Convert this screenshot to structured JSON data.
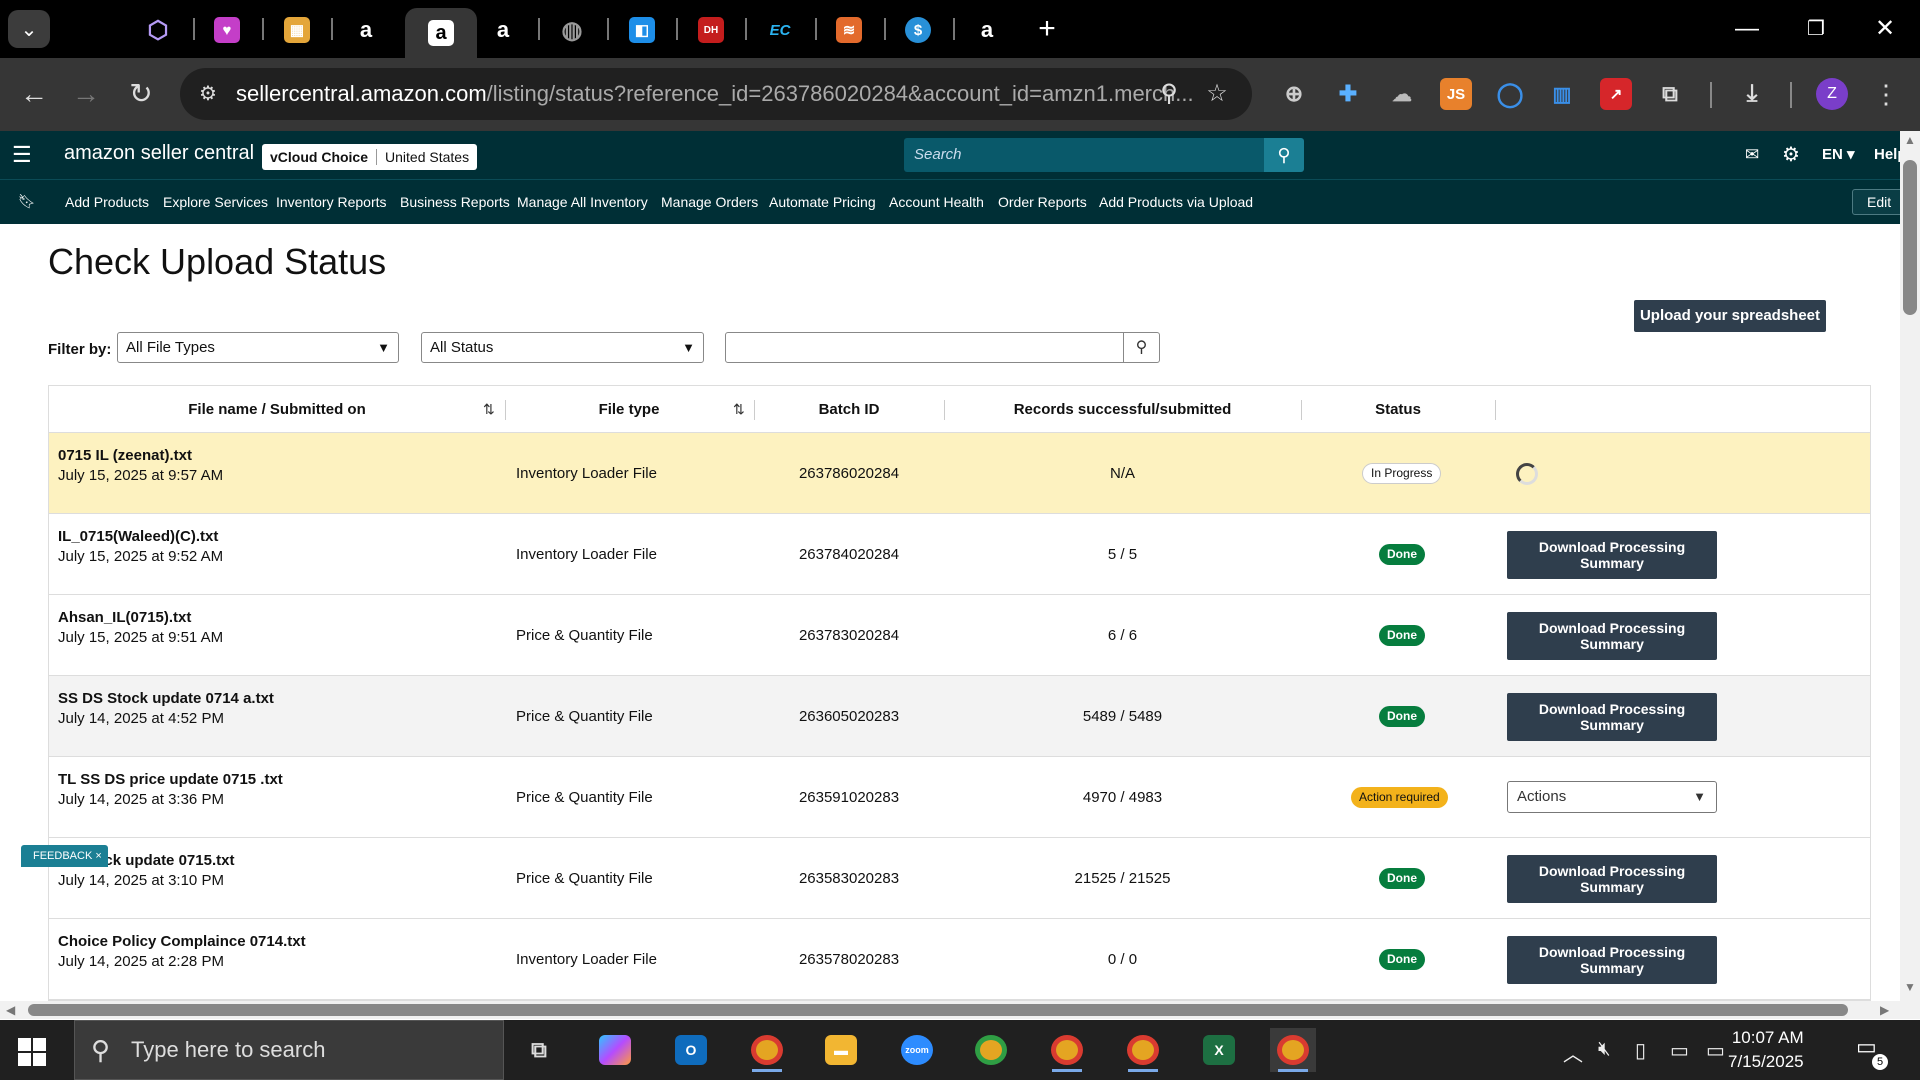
{
  "browser": {
    "url_host": "sellercentral.amazon.com",
    "url_path": "/listing/status?reference_id=263786020284&account_id=amzn1.merch...",
    "new_tab_label": "+"
  },
  "header": {
    "logo_text": "amazon seller central",
    "account_name": "vCloud Choice",
    "marketplace": "United States",
    "search_placeholder": "Search",
    "language": "EN",
    "help": "Help"
  },
  "nav": {
    "items": [
      "Add Products",
      "Explore Services",
      "Inventory Reports",
      "Business Reports",
      "Manage All Inventory",
      "Manage Orders",
      "Automate Pricing",
      "Account Health",
      "Order Reports",
      "Add Products via Upload"
    ],
    "edit_label": "Edit"
  },
  "page": {
    "title": "Check Upload Status",
    "upload_button": "Upload your spreadsheet",
    "filter_label": "Filter by:",
    "file_type_filter": "All File Types",
    "status_filter": "All Status",
    "search_value": ""
  },
  "table": {
    "columns": [
      "File name / Submitted on",
      "File type",
      "Batch ID",
      "Records successful/submitted",
      "Status"
    ],
    "rows": [
      {
        "name": "0715 IL (zeenat).txt",
        "date": "July 15, 2025 at 9:57 AM",
        "type": "Inventory Loader File",
        "batch": "263786020284",
        "records": "N/A",
        "status": "In Progress",
        "action": "spinner"
      },
      {
        "name": "IL_0715(Waleed)(C).txt",
        "date": "July 15, 2025 at 9:52 AM",
        "type": "Inventory Loader File",
        "batch": "263784020284",
        "records": "5 / 5",
        "status": "Done",
        "action": "Download Processing Summary"
      },
      {
        "name": "Ahsan_IL(0715).txt",
        "date": "July 15, 2025 at 9:51 AM",
        "type": "Price & Quantity File",
        "batch": "263783020284",
        "records": "6 / 6",
        "status": "Done",
        "action": "Download Processing Summary"
      },
      {
        "name": "SS DS Stock update 0714 a.txt",
        "date": "July 14, 2025 at 4:52 PM",
        "type": "Price & Quantity File",
        "batch": "263605020283",
        "records": "5489 / 5489",
        "status": "Done",
        "action": "Download Processing Summary"
      },
      {
        "name": "TL SS DS price update 0715 .txt",
        "date": "July 14, 2025 at 3:36 PM",
        "type": "Price & Quantity File",
        "batch": "263591020283",
        "records": "4970 / 4983",
        "status": "Action required",
        "action": "Actions"
      },
      {
        "name": "TL Stock update 0715.txt",
        "date": "July 14, 2025 at 3:10 PM",
        "type": "Price & Quantity File",
        "batch": "263583020283",
        "records": "21525 / 21525",
        "status": "Done",
        "action": "Download Processing Summary"
      },
      {
        "name": "Choice Policy Complaince 0714.txt",
        "date": "July 14, 2025 at 2:28 PM",
        "type": "Inventory Loader File",
        "batch": "263578020283",
        "records": "0 / 0",
        "status": "Done",
        "action": "Download Processing Summary"
      }
    ]
  },
  "feedback": {
    "label": "FEEDBACK",
    "close": "×"
  },
  "taskbar": {
    "search_placeholder": "Type here to search",
    "time": "10:07 AM",
    "date": "7/15/2025",
    "notifications": "5",
    "zoom_label": "zoom"
  },
  "colors": {
    "header_bg": "#002f36",
    "button_dark": "#2f3e4d",
    "done_green": "#067d3e",
    "action_yellow": "#f3b21b",
    "highlight_row": "#fdf2c0"
  }
}
